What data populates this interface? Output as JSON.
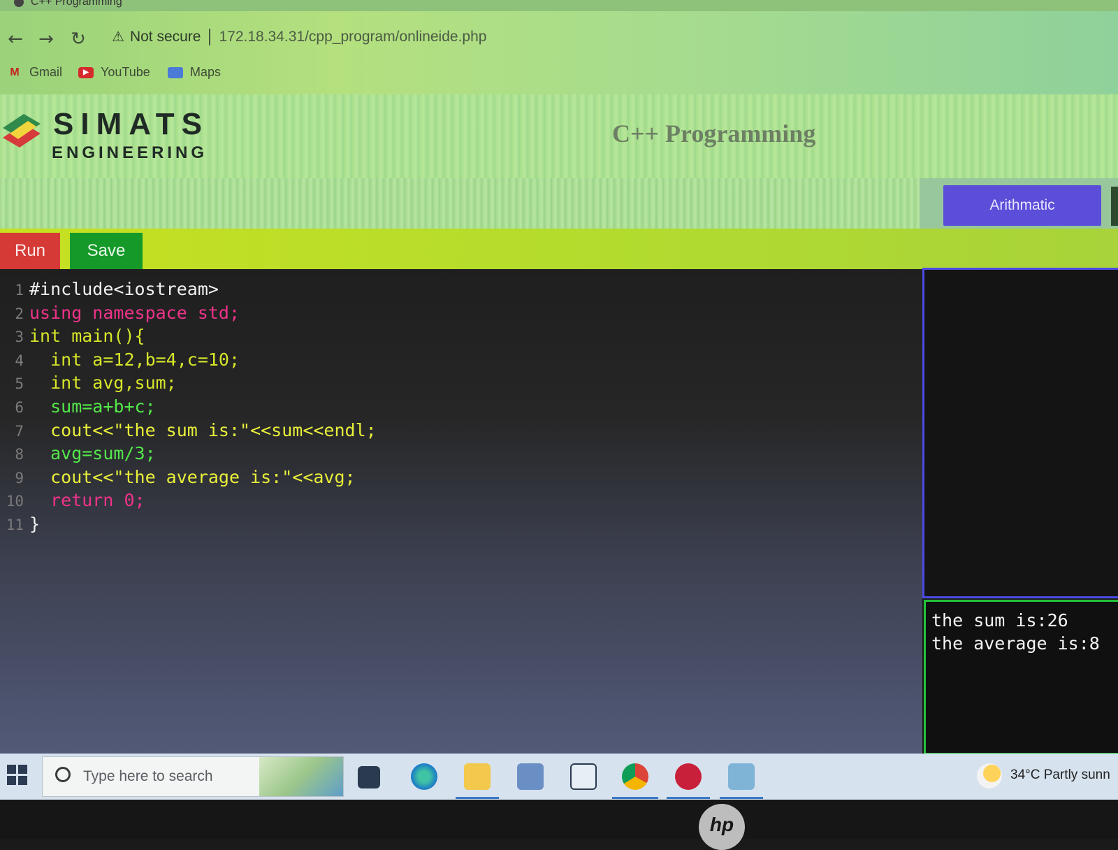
{
  "browser": {
    "tab_title": "C++ Programming",
    "security_label": "Not secure",
    "url": "172.18.34.31/cpp_program/onlineide.php",
    "bookmarks": [
      {
        "label": "Gmail",
        "icon": "gmail-icon"
      },
      {
        "label": "YouTube",
        "icon": "youtube-icon"
      },
      {
        "label": "Maps",
        "icon": "maps-icon"
      }
    ]
  },
  "site": {
    "logo_title": "SIMATS",
    "logo_subtitle": "ENGINEERING",
    "page_title": "C++ Programming",
    "menu_button": "Arithmatic"
  },
  "toolbar": {
    "run_label": "Run",
    "save_label": "Save"
  },
  "editor": {
    "line_numbers": [
      "1",
      "2",
      "3",
      "4",
      "5",
      "6",
      "7",
      "8",
      "9",
      "10",
      "11"
    ],
    "lines": [
      "#include<iostream>",
      "using namespace std;",
      "int main(){",
      "  int a=12,b=4,c=10;",
      "  int avg,sum;",
      "  sum=a+b+c;",
      "  cout<<\"the sum is:\"<<sum<<endl;",
      "  avg=sum/3;",
      "  cout<<\"the average is:\"<<avg;",
      "  return 0;",
      "}"
    ]
  },
  "output": {
    "lines": [
      "the sum is:26",
      "the average is:8"
    ]
  },
  "taskbar": {
    "search_placeholder": "Type here to search",
    "weather": "34°C  Partly sunn",
    "apps": [
      "task-view-icon",
      "edge-icon",
      "file-explorer-icon",
      "store-icon",
      "mail-icon",
      "chrome-icon",
      "devcpp-icon",
      "app-window-icon"
    ]
  },
  "colors": {
    "run": "#d63a36",
    "save": "#159a2a",
    "menu_button": "#5b4ed8",
    "toolbar": "#c7e021",
    "input_border": "#4d4ae6",
    "output_border": "#23c23b"
  }
}
